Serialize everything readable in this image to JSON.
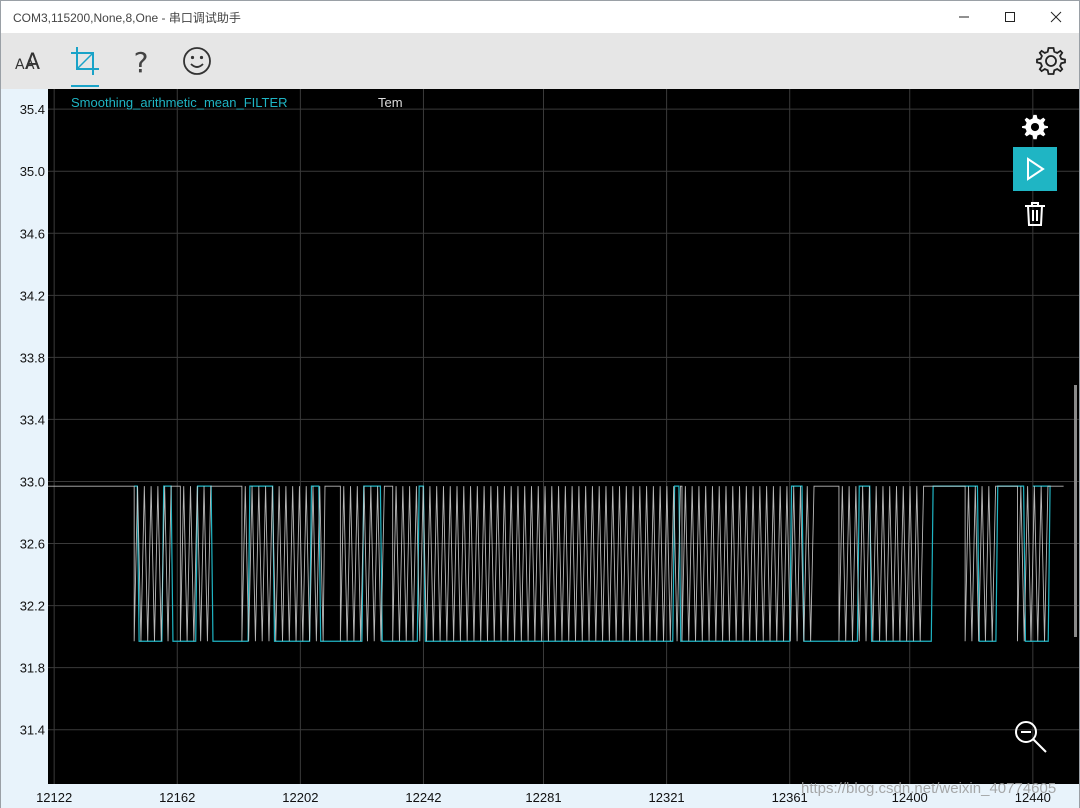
{
  "window": {
    "title": "COM3,115200,None,8,One - 串口调试助手"
  },
  "toolbar": {
    "items": [
      {
        "name": "font-size-icon",
        "glyph": "AA"
      },
      {
        "name": "crop-icon"
      },
      {
        "name": "help-icon",
        "glyph": "?"
      },
      {
        "name": "smiley-icon"
      }
    ]
  },
  "side_controls": [
    "gear-icon",
    "play-icon",
    "trash-icon",
    "zoom-out-icon"
  ],
  "colors": {
    "plot_bg": "#000000",
    "grid": "#3a3a3a",
    "filtered_series": "#1fb5c4",
    "raw_series": "#d8d8d8",
    "axis_text": "#111111",
    "accent": "#1aa3c8"
  },
  "watermark": "https://blog.csdn.net/weixin_40774605",
  "chart_data": {
    "type": "line",
    "legend": [
      "Smoothing_arithmetic_mean_FILTER",
      "Tem"
    ],
    "legend_position": "top-left",
    "grid": true,
    "xlim": [
      12120,
      12455
    ],
    "ylim": [
      31.05,
      35.53
    ],
    "x_ticks": [
      "12122",
      "12162",
      "12202",
      "12242",
      "12281",
      "12321",
      "12361",
      "12400",
      "12440"
    ],
    "y_ticks": [
      "35.4",
      "35.0",
      "34.6",
      "34.2",
      "33.8",
      "33.4",
      "33.0",
      "32.6",
      "32.2",
      "31.8",
      "31.4"
    ],
    "series": [
      {
        "name": "Smoothing_arithmetic_mean_FILTER",
        "low_value": 31.97,
        "high_value": 32.97,
        "x_start": 12148,
        "x_end": 12440,
        "low_intervals": [
          [
            12149,
            12157
          ],
          [
            12160,
            12168
          ],
          [
            12173,
            12185
          ],
          [
            12193,
            12205
          ],
          [
            12208,
            12222
          ],
          [
            12228,
            12240
          ],
          [
            12242,
            12323
          ],
          [
            12325,
            12361
          ],
          [
            12365,
            12383
          ],
          [
            12387,
            12407
          ],
          [
            12422,
            12428
          ],
          [
            12437,
            12445
          ]
        ]
      },
      {
        "name": "Tem",
        "low_value": 31.97,
        "high_value": 32.97,
        "x_start": 12120,
        "x_end": 12450,
        "toggle_regions": [
          [
            12148,
            12160
          ],
          [
            12163,
            12174
          ],
          [
            12183,
            12210
          ],
          [
            12215,
            12230
          ],
          [
            12232,
            12326
          ],
          [
            12326,
            12370
          ],
          [
            12377,
            12405
          ],
          [
            12418,
            12428
          ],
          [
            12435,
            12445
          ]
        ]
      }
    ]
  }
}
